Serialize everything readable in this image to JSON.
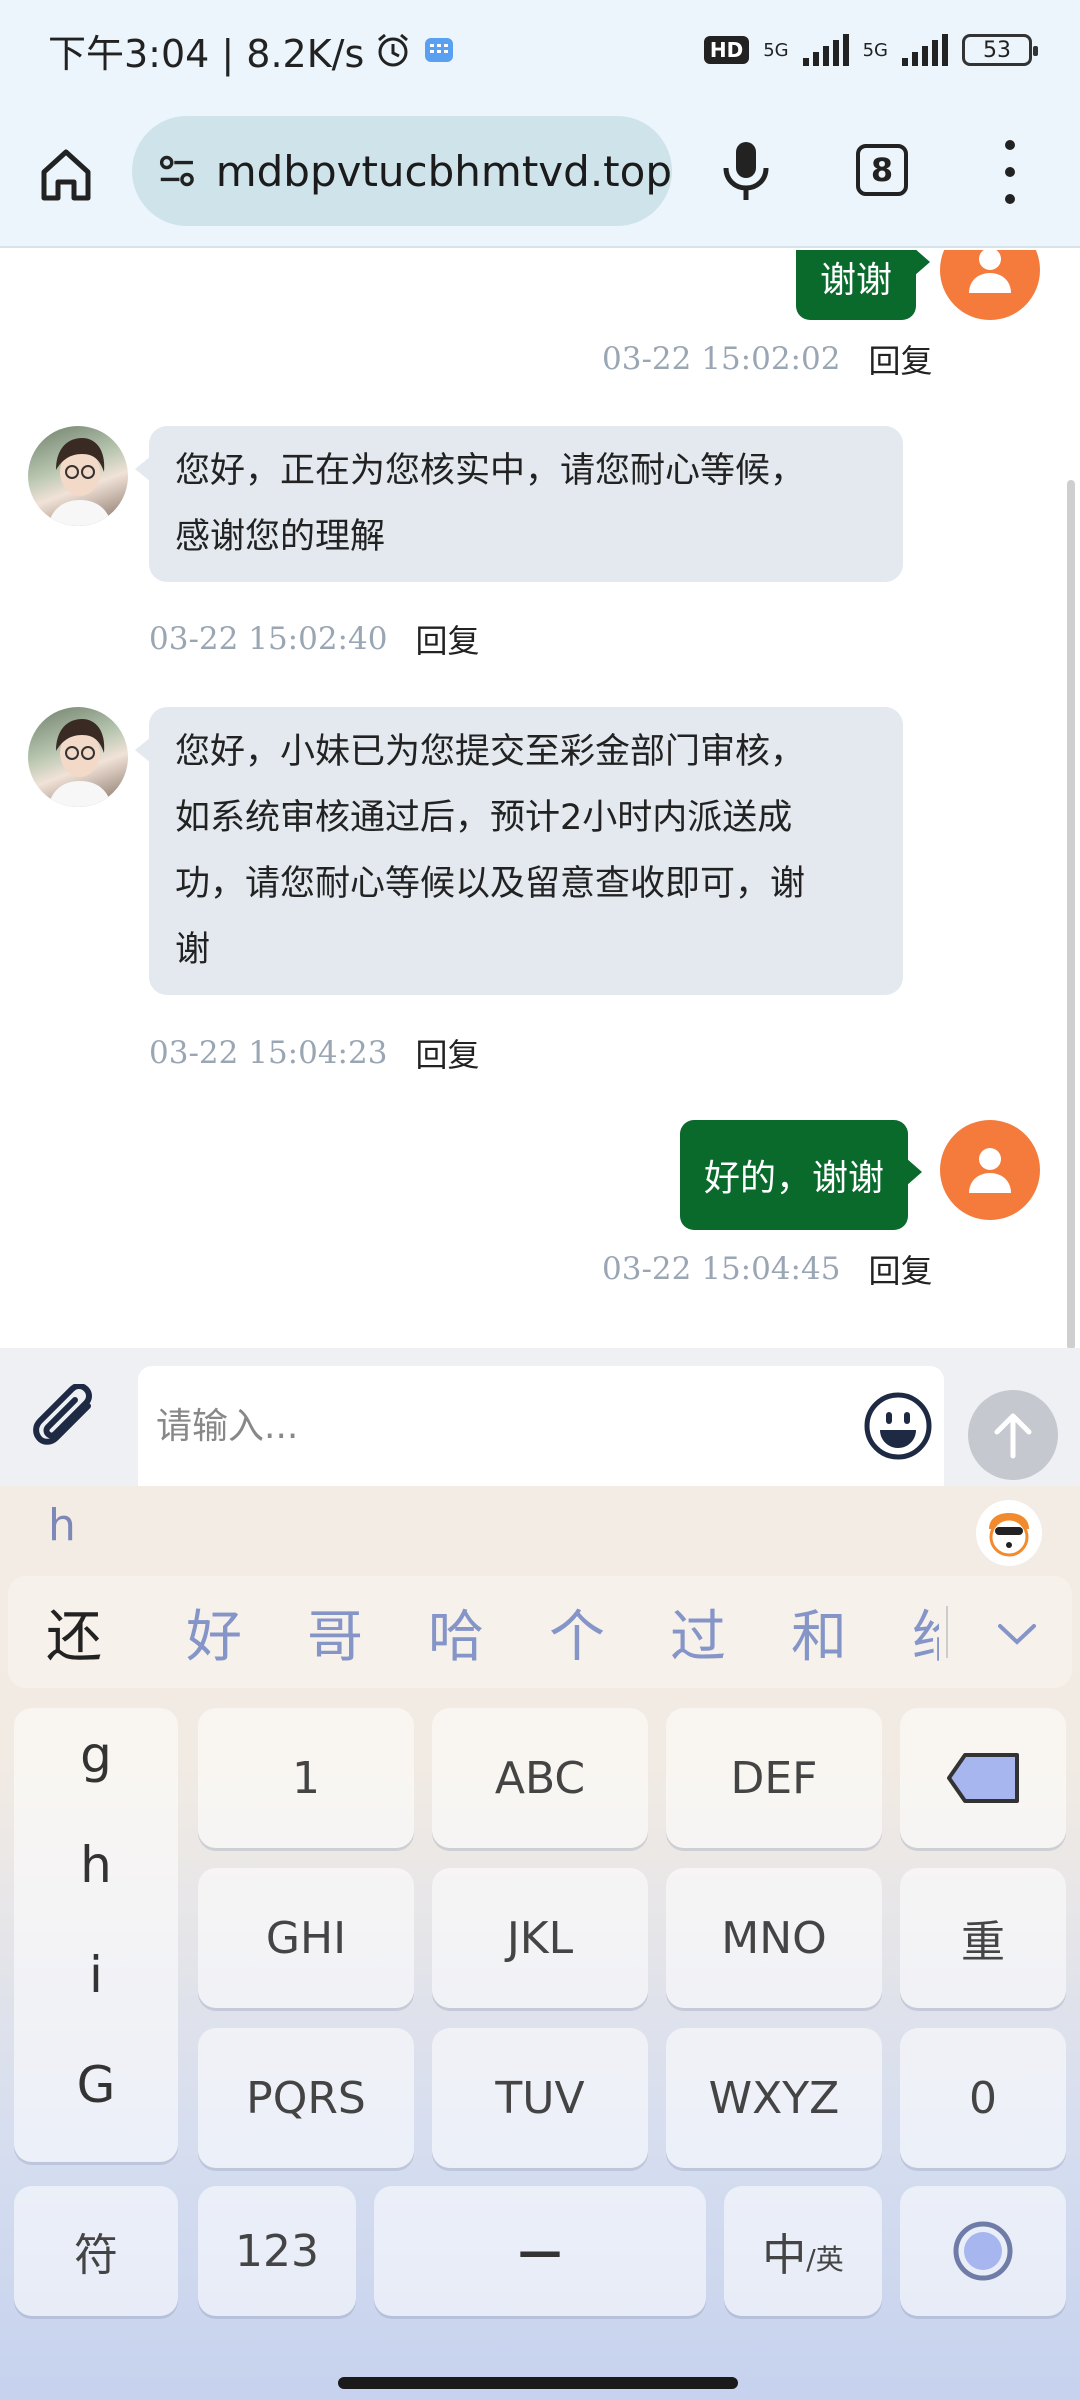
{
  "status_bar": {
    "time_speed": "下午3:04 | 8.2K/s",
    "hd_label": "HD",
    "net1": "5G",
    "net2": "5G",
    "battery": "53"
  },
  "browser": {
    "url": "mdbpvtucbhmtvd.top",
    "tab_count": "8"
  },
  "chat": {
    "messages": [
      {
        "side": "out",
        "text": "谢谢",
        "time": "03-22 15:02:02",
        "reply": "回复"
      },
      {
        "side": "in",
        "lines": [
          "您好，正在为您核实中，请您耐心等候，",
          "感谢您的理解"
        ],
        "time": "03-22 15:02:40",
        "reply": "回复"
      },
      {
        "side": "in",
        "lines": [
          "您好，小妹已为您提交至彩金部门审核，",
          "如系统审核通过后，预计2小时内派送成",
          "功，请您耐心等候以及留意查收即可，谢",
          "谢"
        ],
        "time": "03-22 15:04:23",
        "reply": "回复"
      },
      {
        "side": "out",
        "text": "好的，谢谢",
        "time": "03-22 15:04:45",
        "reply": "回复"
      }
    ]
  },
  "input": {
    "placeholder": "请输入..."
  },
  "keyboard": {
    "composition": "h",
    "candidates": [
      "还",
      "好",
      "哥",
      "哈",
      "个",
      "过",
      "和",
      "给"
    ],
    "left_column": [
      "g",
      "h",
      "i",
      "G"
    ],
    "row1": [
      "1",
      "ABC",
      "DEF"
    ],
    "row2": [
      "GHI",
      "JKL",
      "MNO",
      "重"
    ],
    "row3": [
      "PQRS",
      "TUV",
      "WXYZ",
      "0"
    ],
    "row4": {
      "symbols": "符",
      "numbers": "123",
      "space": "—",
      "lang_main": "中",
      "lang_sub": "/英"
    }
  },
  "colors": {
    "outgoing_bubble": "#0a6a2c",
    "incoming_bubble": "#e4e9ef",
    "user_avatar": "#f47b3b",
    "timestamp": "#9aa6b3"
  }
}
